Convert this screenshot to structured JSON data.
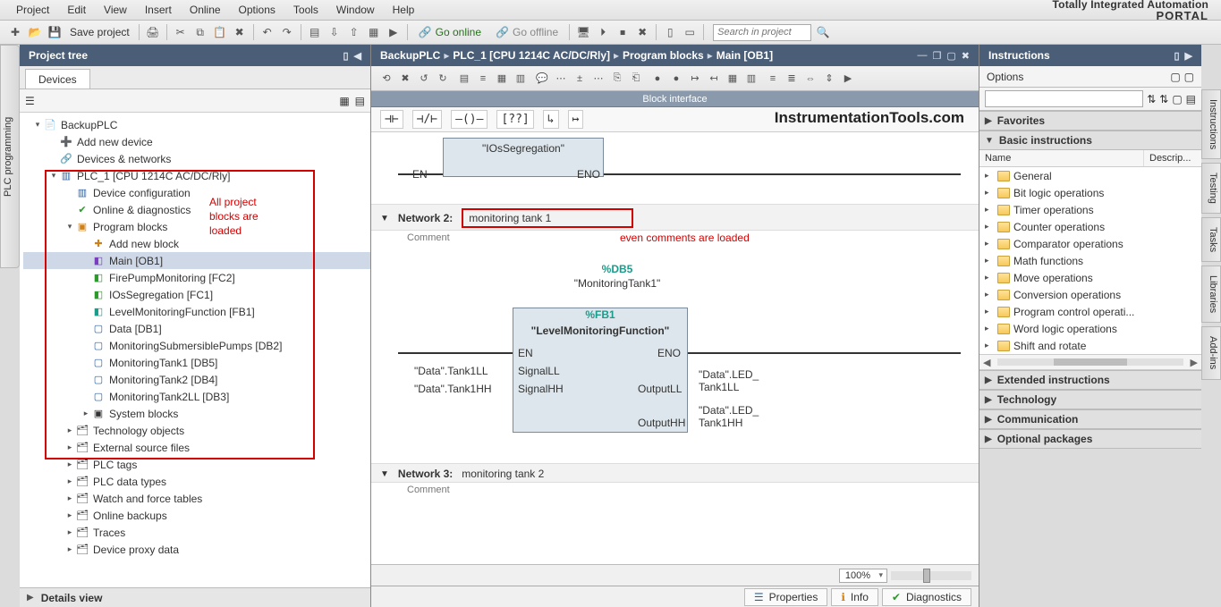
{
  "branding": {
    "line1": "Totally Integrated Automation",
    "line2": "PORTAL"
  },
  "menu": {
    "items": [
      "Project",
      "Edit",
      "View",
      "Insert",
      "Online",
      "Options",
      "Tools",
      "Window",
      "Help"
    ]
  },
  "toolbar": {
    "save_label": "Save project",
    "go_online": "Go online",
    "go_offline": "Go offline",
    "search_placeholder": "Search in project"
  },
  "left_side_tab": "PLC programming",
  "right_side_tabs": [
    "Instructions",
    "Testing",
    "Tasks",
    "Libraries",
    "Add-ins"
  ],
  "project_tree": {
    "header": "Project tree",
    "devices_tab": "Devices",
    "nodes": [
      {
        "depth": 0,
        "arrow": "▾",
        "icon": "📄",
        "text": "BackupPLC"
      },
      {
        "depth": 1,
        "arrow": "",
        "icon": "➕",
        "text": "Add new device",
        "icolor": "ic-orange"
      },
      {
        "depth": 1,
        "arrow": "",
        "icon": "🔗",
        "text": "Devices & networks"
      },
      {
        "depth": 1,
        "arrow": "▾",
        "icon": "▥",
        "text": "PLC_1 [CPU 1214C AC/DC/Rly]",
        "icolor": "ic-blue"
      },
      {
        "depth": 2,
        "arrow": "",
        "icon": "▥",
        "text": "Device configuration",
        "icolor": "ic-blue"
      },
      {
        "depth": 2,
        "arrow": "",
        "icon": "✔",
        "text": "Online & diagnostics",
        "icolor": "ic-green"
      },
      {
        "depth": 2,
        "arrow": "▾",
        "icon": "▣",
        "text": "Program blocks",
        "icolor": "ic-orange"
      },
      {
        "depth": 3,
        "arrow": "",
        "icon": "✚",
        "text": "Add new block",
        "icolor": "ic-orange"
      },
      {
        "depth": 3,
        "arrow": "",
        "icon": "◧",
        "text": "Main [OB1]",
        "selected": true,
        "icolor": "ic-purple"
      },
      {
        "depth": 3,
        "arrow": "",
        "icon": "◧",
        "text": "FirePumpMonitoring [FC2]",
        "icolor": "ic-green"
      },
      {
        "depth": 3,
        "arrow": "",
        "icon": "◧",
        "text": "IOsSegregation [FC1]",
        "icolor": "ic-green"
      },
      {
        "depth": 3,
        "arrow": "",
        "icon": "◧",
        "text": "LevelMonitoringFunction [FB1]",
        "icolor": "ic-cyan"
      },
      {
        "depth": 3,
        "arrow": "",
        "icon": "▢",
        "text": "Data [DB1]",
        "icolor": "ic-blue"
      },
      {
        "depth": 3,
        "arrow": "",
        "icon": "▢",
        "text": "MonitoringSubmersiblePumps [DB2]",
        "icolor": "ic-blue"
      },
      {
        "depth": 3,
        "arrow": "",
        "icon": "▢",
        "text": "MonitoringTank1 [DB5]",
        "icolor": "ic-blue"
      },
      {
        "depth": 3,
        "arrow": "",
        "icon": "▢",
        "text": "MonitoringTank2 [DB4]",
        "icolor": "ic-blue"
      },
      {
        "depth": 3,
        "arrow": "",
        "icon": "▢",
        "text": "MonitoringTank2LL [DB3]",
        "icolor": "ic-blue"
      },
      {
        "depth": 3,
        "arrow": "▸",
        "icon": "▣",
        "text": "System blocks"
      },
      {
        "depth": 2,
        "arrow": "▸",
        "icon": "🗂",
        "text": "Technology objects"
      },
      {
        "depth": 2,
        "arrow": "▸",
        "icon": "🗂",
        "text": "External source files"
      },
      {
        "depth": 2,
        "arrow": "▸",
        "icon": "🗂",
        "text": "PLC tags"
      },
      {
        "depth": 2,
        "arrow": "▸",
        "icon": "🗂",
        "text": "PLC data types"
      },
      {
        "depth": 2,
        "arrow": "▸",
        "icon": "🗂",
        "text": "Watch and force tables"
      },
      {
        "depth": 2,
        "arrow": "▸",
        "icon": "🗂",
        "text": "Online backups"
      },
      {
        "depth": 2,
        "arrow": "▸",
        "icon": "🗂",
        "text": "Traces"
      },
      {
        "depth": 2,
        "arrow": "▸",
        "icon": "🗂",
        "text": "Device proxy data"
      }
    ],
    "annotation": "All project\nblocks are\nloaded",
    "details_view": "Details view"
  },
  "editor": {
    "breadcrumbs": [
      "BackupPLC",
      "PLC_1 [CPU 1214C AC/DC/Rly]",
      "Program blocks",
      "Main [OB1]"
    ],
    "block_interface": "Block interface",
    "watermark": "InstrumentationTools.com",
    "net1": {
      "block_name": "\"IOsSegregation\"",
      "en": "EN",
      "eno": "ENO"
    },
    "net2": {
      "label": "Network 2:",
      "title": "monitoring tank 1",
      "comment": "Comment",
      "annotation": "even comments are loaded",
      "db_sym": "%DB5",
      "db_name": "\"MonitoringTank1\"",
      "fb_sym": "%FB1",
      "fb_name": "\"LevelMonitoringFunction\"",
      "ports": {
        "en": "EN",
        "eno": "ENO",
        "sigLL": "SignalLL",
        "sigHH": "SignalHH",
        "outLL": "OutputLL",
        "outHH": "OutputHH",
        "inLL": "\"Data\".Tank1LL",
        "inHH": "\"Data\".Tank1HH",
        "ledLL1": "\"Data\".LED_",
        "ledLL2": "Tank1LL",
        "ledHH1": "\"Data\".LED_",
        "ledHH2": "Tank1HH"
      }
    },
    "net3": {
      "label": "Network 3:",
      "title": "monitoring tank 2",
      "comment": "Comment"
    },
    "footer": {
      "zoom": "100%",
      "tabs": {
        "properties": "Properties",
        "info": "Info",
        "diagnostics": "Diagnostics"
      }
    }
  },
  "instructions": {
    "header": "Instructions",
    "options": "Options",
    "favorites": "Favorites",
    "basic": "Basic instructions",
    "col_name": "Name",
    "col_desc": "Descrip...",
    "rows": [
      "General",
      "Bit logic operations",
      "Timer operations",
      "Counter operations",
      "Comparator operations",
      "Math functions",
      "Move operations",
      "Conversion operations",
      "Program control operati...",
      "Word logic operations",
      "Shift and rotate"
    ],
    "sections": [
      "Extended instructions",
      "Technology",
      "Communication",
      "Optional packages"
    ]
  }
}
